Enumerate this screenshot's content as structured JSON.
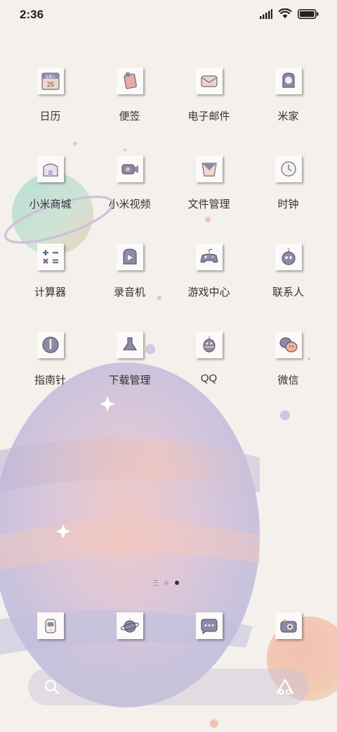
{
  "status_bar": {
    "time": "2:36"
  },
  "apps": [
    {
      "name": "日历",
      "icon": "calendar-icon",
      "badge": "星期三",
      "day": "25"
    },
    {
      "name": "便签",
      "icon": "notes-icon"
    },
    {
      "name": "电子邮件",
      "icon": "mail-icon"
    },
    {
      "name": "米家",
      "icon": "mijia-icon"
    },
    {
      "name": "小米商城",
      "icon": "mi-store-icon"
    },
    {
      "name": "小米视频",
      "icon": "mi-video-icon"
    },
    {
      "name": "文件管理",
      "icon": "file-manager-icon"
    },
    {
      "name": "时钟",
      "icon": "clock-icon"
    },
    {
      "name": "计算器",
      "icon": "calculator-icon"
    },
    {
      "name": "录音机",
      "icon": "recorder-icon"
    },
    {
      "name": "游戏中心",
      "icon": "game-center-icon"
    },
    {
      "name": "联系人",
      "icon": "contacts-icon"
    },
    {
      "name": "指南针",
      "icon": "compass-icon"
    },
    {
      "name": "下载管理",
      "icon": "downloads-icon"
    },
    {
      "name": "QQ",
      "icon": "qq-icon"
    },
    {
      "name": "微信",
      "icon": "wechat-icon"
    }
  ],
  "dock": [
    {
      "icon": "phone-icon"
    },
    {
      "icon": "browser-icon"
    },
    {
      "icon": "messages-icon"
    },
    {
      "icon": "camera-icon"
    }
  ],
  "page_indicator": {
    "pages": 2,
    "active": 2
  },
  "search_bar": {
    "left_icon": "search-icon",
    "right_icon": "assistant-icon"
  }
}
